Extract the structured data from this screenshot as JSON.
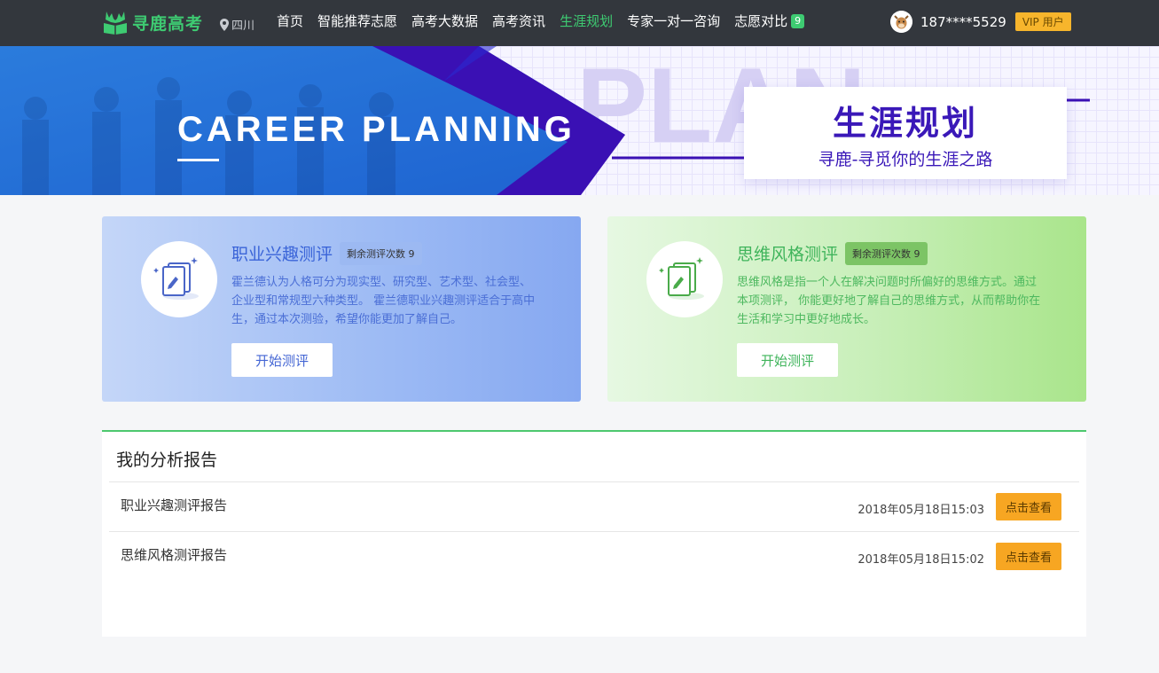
{
  "nav": {
    "logo_text": "寻鹿高考",
    "location": "四川",
    "menu": [
      {
        "label": "首页"
      },
      {
        "label": "智能推荐志愿"
      },
      {
        "label": "高考大数据"
      },
      {
        "label": "高考资讯"
      },
      {
        "label": "生涯规划"
      },
      {
        "label": "专家一对一咨询"
      },
      {
        "label": "志愿对比"
      }
    ],
    "compare_count": "9",
    "active_color": "#3ecb72",
    "user": {
      "phone": "187****5529",
      "vip_label": "VIP 用户"
    }
  },
  "banner": {
    "en_title": "CAREER PLANNING",
    "bg_word": "PLAN",
    "title": "生涯规划",
    "subtitle": "寻鹿-寻觅你的生涯之路"
  },
  "cards": [
    {
      "title": "职业兴趣测评",
      "count_label": "剩余测评次数 9",
      "desc": "霍兰德认为人格可分为现实型、研究型、艺术型、社会型、企业型和常规型六种类型。 霍兰德职业兴趣测评适合于高中生，通过本次测验，希望你能更加了解自己。",
      "button": "开始测评",
      "icon": "pencil-document-icon",
      "color": "#3a64d8"
    },
    {
      "title": "思维风格测评",
      "count_label": "剩余测评次数 9",
      "desc": "思维风格是指一个人在解决问题时所偏好的思维方式。通过本项测评， 你能更好地了解自己的思维方式，从而帮助你在生活和学习中更好地成长。",
      "button": "开始测评",
      "icon": "pencil-document-icon",
      "color": "#3fb45b"
    }
  ],
  "reports": {
    "title": "我的分析报告",
    "rows": [
      {
        "name": "职业兴趣测评报告",
        "date": "2018年05月18日15:03",
        "button": "点击查看"
      },
      {
        "name": "思维风格测评报告",
        "date": "2018年05月18日15:02",
        "button": "点击查看"
      }
    ]
  }
}
